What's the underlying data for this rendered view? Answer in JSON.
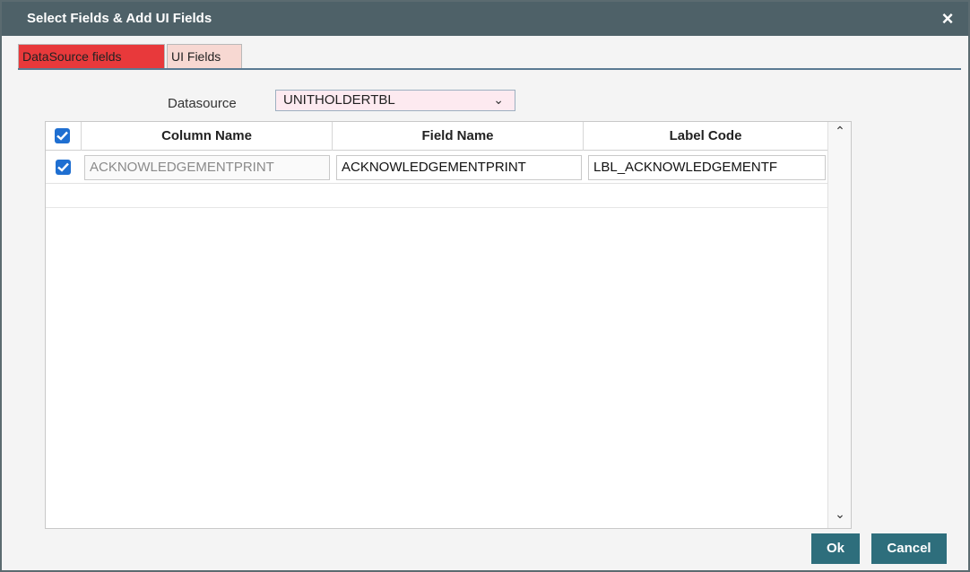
{
  "dialog": {
    "title": "Select Fields & Add UI Fields",
    "close_icon": "×"
  },
  "tabs": [
    {
      "label": "DataSource fields",
      "active": true
    },
    {
      "label": "UI Fields",
      "active": false
    }
  ],
  "datasource": {
    "label": "Datasource",
    "selected": "UNITHOLDERTBL",
    "chevron": "⌄"
  },
  "grid": {
    "columns": [
      "Column Name",
      "Field Name",
      "Label Code"
    ],
    "header_checked": true,
    "rows": [
      {
        "checked": true,
        "column_name": "ACKNOWLEDGEMENTPRINT",
        "field_name": "ACKNOWLEDGEMENTPRINT",
        "label_code": "LBL_ACKNOWLEDGEMENTF"
      }
    ],
    "scroll_up_icon": "⌃",
    "scroll_down_icon": "⌄"
  },
  "buttons": {
    "ok": "Ok",
    "cancel": "Cancel"
  },
  "colors": {
    "titlebar": "#4e6168",
    "active_tab": "#e8393b",
    "inactive_tab": "#f7d8d2",
    "button": "#2e6e7c",
    "checkbox": "#1f6fd1"
  }
}
